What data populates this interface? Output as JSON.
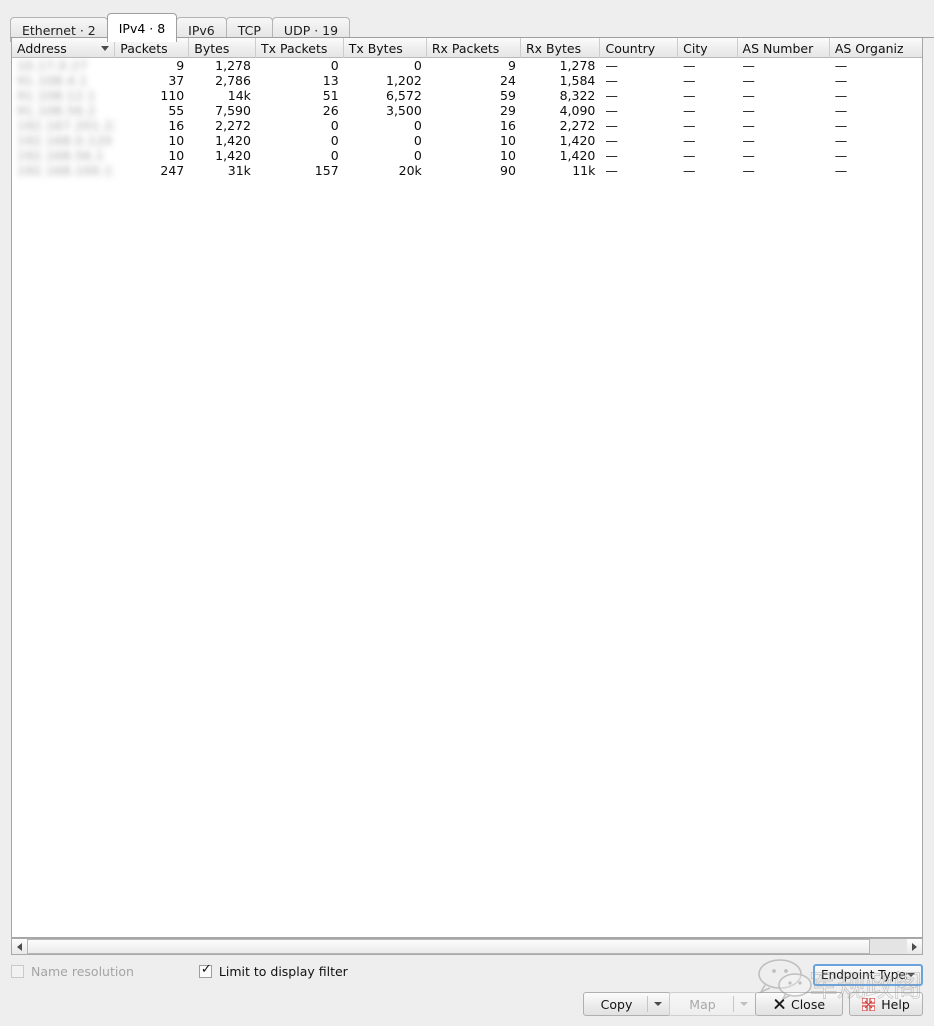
{
  "tabs": [
    {
      "label": "Ethernet · 2",
      "active": false
    },
    {
      "label": "IPv4 · 8",
      "active": true
    },
    {
      "label": "IPv6",
      "active": false
    },
    {
      "label": "TCP",
      "active": false
    },
    {
      "label": "UDP · 19",
      "active": false
    }
  ],
  "table": {
    "columns": [
      {
        "key": "address",
        "label": "Address",
        "align": "left",
        "sorted": "desc"
      },
      {
        "key": "packets",
        "label": "Packets",
        "align": "right"
      },
      {
        "key": "bytes",
        "label": "Bytes",
        "align": "right"
      },
      {
        "key": "tx_packets",
        "label": "Tx Packets",
        "align": "right"
      },
      {
        "key": "tx_bytes",
        "label": "Tx Bytes",
        "align": "right"
      },
      {
        "key": "rx_packets",
        "label": "Rx Packets",
        "align": "right"
      },
      {
        "key": "rx_bytes",
        "label": "Rx Bytes",
        "align": "right"
      },
      {
        "key": "country",
        "label": "Country",
        "align": "left"
      },
      {
        "key": "city",
        "label": "City",
        "align": "left"
      },
      {
        "key": "as_number",
        "label": "AS Number",
        "align": "left"
      },
      {
        "key": "as_org",
        "label": "AS Organiz",
        "align": "left"
      }
    ],
    "rows": [
      {
        "address": "10.17.0.27",
        "packets": "9",
        "bytes": "1,278",
        "tx_packets": "0",
        "tx_bytes": "0",
        "rx_packets": "9",
        "rx_bytes": "1,278",
        "country": "—",
        "city": "—",
        "as_number": "—",
        "as_org": "—"
      },
      {
        "address": "91.108.4.1",
        "packets": "37",
        "bytes": "2,786",
        "tx_packets": "13",
        "tx_bytes": "1,202",
        "rx_packets": "24",
        "rx_bytes": "1,584",
        "country": "—",
        "city": "—",
        "as_number": "—",
        "as_org": "—"
      },
      {
        "address": "91.108.12.1",
        "packets": "110",
        "bytes": "14k",
        "tx_packets": "51",
        "tx_bytes": "6,572",
        "rx_packets": "59",
        "rx_bytes": "8,322",
        "country": "—",
        "city": "—",
        "as_number": "—",
        "as_org": "—"
      },
      {
        "address": "91.108.56.2",
        "packets": "55",
        "bytes": "7,590",
        "tx_packets": "26",
        "tx_bytes": "3,500",
        "rx_packets": "29",
        "rx_bytes": "4,090",
        "country": "—",
        "city": "—",
        "as_number": "—",
        "as_org": "—"
      },
      {
        "address": "192.167.201.227",
        "packets": "16",
        "bytes": "2,272",
        "tx_packets": "0",
        "tx_bytes": "0",
        "rx_packets": "16",
        "rx_bytes": "2,272",
        "country": "—",
        "city": "—",
        "as_number": "—",
        "as_org": "—"
      },
      {
        "address": "192.168.0.120",
        "packets": "10",
        "bytes": "1,420",
        "tx_packets": "0",
        "tx_bytes": "0",
        "rx_packets": "10",
        "rx_bytes": "1,420",
        "country": "—",
        "city": "—",
        "as_number": "—",
        "as_org": "—"
      },
      {
        "address": "192.168.56.1",
        "packets": "10",
        "bytes": "1,420",
        "tx_packets": "0",
        "tx_bytes": "0",
        "rx_packets": "10",
        "rx_bytes": "1,420",
        "country": "—",
        "city": "—",
        "as_number": "—",
        "as_org": "—"
      },
      {
        "address": "192.168.100.11",
        "packets": "247",
        "bytes": "31k",
        "tx_packets": "157",
        "tx_bytes": "20k",
        "rx_packets": "90",
        "rx_bytes": "11k",
        "country": "—",
        "city": "—",
        "as_number": "—",
        "as_org": "—"
      }
    ]
  },
  "options": {
    "name_resolution": {
      "label": "Name resolution",
      "checked": false,
      "enabled": false
    },
    "limit_to_display_filter": {
      "label": "Limit to display filter",
      "checked": true,
      "enabled": true
    }
  },
  "endpoint_types": {
    "label": "Endpoint Types"
  },
  "buttons": {
    "copy": {
      "label": "Copy",
      "enabled": true,
      "has_menu": true
    },
    "map": {
      "label": "Map",
      "enabled": false,
      "has_menu": true
    },
    "close": {
      "label": "Close",
      "enabled": true,
      "icon": "close-x-icon"
    },
    "help": {
      "label": "Help",
      "enabled": true,
      "icon": "help-icon"
    }
  },
  "watermark": {
    "text": "军规政阁",
    "logo": "wechat-icon"
  },
  "colors": {
    "window_bg": "#efeeee",
    "table_bg": "#ffffff",
    "active_tab_bg": "#ffffff",
    "focus_border": "#6ba3dd",
    "help_icon": "#d43b3b"
  }
}
